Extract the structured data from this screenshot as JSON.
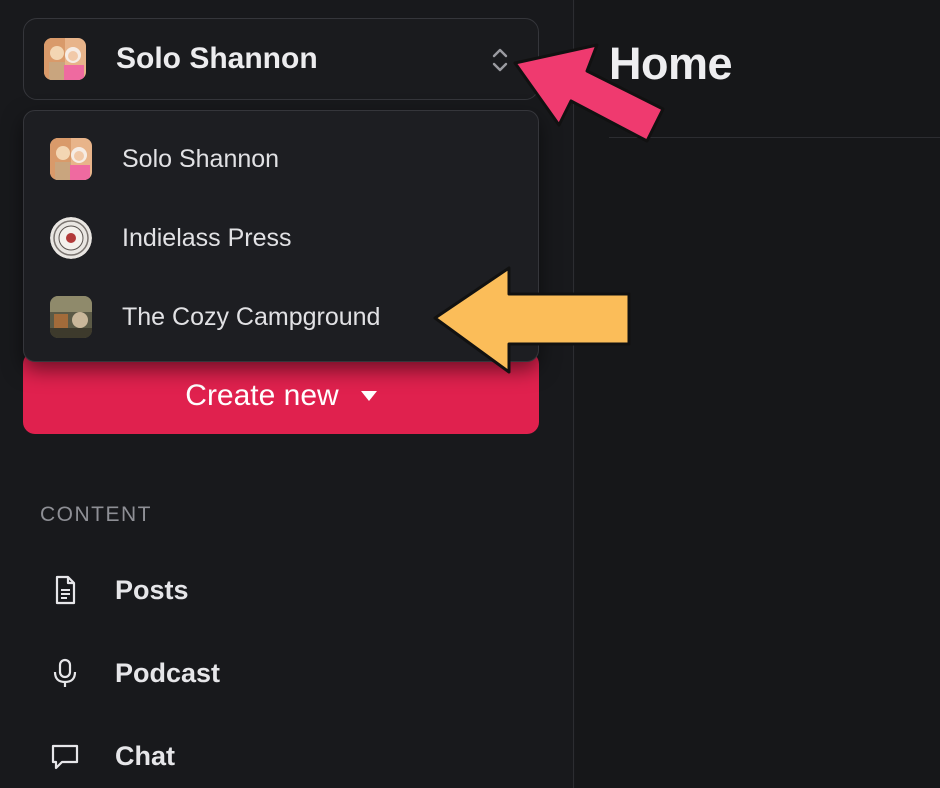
{
  "main": {
    "title": "Home"
  },
  "publication_switcher": {
    "current": "Solo Shannon",
    "icon": "chevron-up-down-icon",
    "options": [
      {
        "label": "Solo Shannon"
      },
      {
        "label": "Indielass Press"
      },
      {
        "label": "The Cozy Campground"
      }
    ]
  },
  "create_button": {
    "label": "Create new",
    "icon": "caret-down-icon"
  },
  "sidebar": {
    "section_label": "CONTENT",
    "items": [
      {
        "label": "Posts",
        "icon": "document-icon"
      },
      {
        "label": "Podcast",
        "icon": "microphone-icon"
      },
      {
        "label": "Chat",
        "icon": "chat-bubble-icon"
      }
    ]
  },
  "annotations": {
    "pink_arrow_color": "#ef3a6f",
    "yellow_arrow_color": "#fbbd59",
    "accent": "#e0214e"
  }
}
